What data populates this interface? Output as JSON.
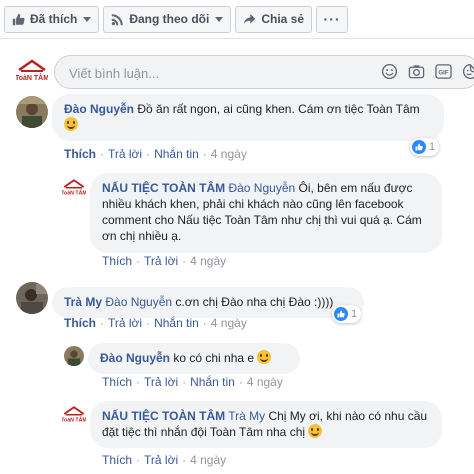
{
  "toolbar": {
    "like_label": "Đã thích",
    "follow_label": "Đang theo dõi",
    "share_label": "Chia sẻ",
    "more_label": "···"
  },
  "composer": {
    "placeholder": "Viết bình luận...",
    "logo_text": "ToàN TÂM",
    "icons": [
      "emoji-icon",
      "camera-icon",
      "gif-icon",
      "sticker-icon"
    ],
    "gif_label": "GIF"
  },
  "comments": [
    {
      "author": "Đào Nguyễn",
      "text": "Đồ ăn rất ngon, ai cũng khen. Cám ơn tiệc Toàn Tâm",
      "actions": {
        "like": "Thích",
        "reply": "Trả lời",
        "message": "Nhắn tin",
        "time": "4 ngày"
      },
      "reaction_count": "1"
    },
    {
      "author": "NẤU TIỆC TOÀN TÂM",
      "tag": "Đào Nguyễn",
      "text": "Ôi, bên em nấu được nhiều khách khen, phải chi khách nào cũng lên facebook comment cho Nấu tiệc Toàn Tâm như chị thì vui quá ạ. Cám ơn chị nhiều ạ.",
      "actions": {
        "like": "Thích",
        "reply": "Trả lời",
        "time": "4 ngày"
      }
    },
    {
      "author": "Trà My",
      "tag": "Đào Nguyễn",
      "text": "c.ơn chị Đào nha chị Đào :))))",
      "actions": {
        "like": "Thích",
        "reply": "Trả lời",
        "message": "Nhắn tin",
        "time": "4 ngày"
      },
      "reaction_count": "1"
    },
    {
      "author": "Đào Nguyễn",
      "text": "ko có chi nha e",
      "actions": {
        "like": "Thích",
        "reply": "Trả lời",
        "message": "Nhắn tin",
        "time": "4 ngày"
      }
    },
    {
      "author": "NẤU TIỆC TOÀN TÂM",
      "tag": "Trà My",
      "text": "Chị My ơi, khi nào có nhu cầu đặt tiệc thì nhắn đội Toàn Tâm nha chị",
      "actions": {
        "like": "Thích",
        "reply": "Trả lời",
        "time": "4 ngày"
      }
    }
  ],
  "colors": {
    "link": "#385898",
    "meta": "#90949c",
    "bubble": "#f2f3f5",
    "like_blue": "#2d88ff",
    "logo_red": "#b3261e"
  }
}
